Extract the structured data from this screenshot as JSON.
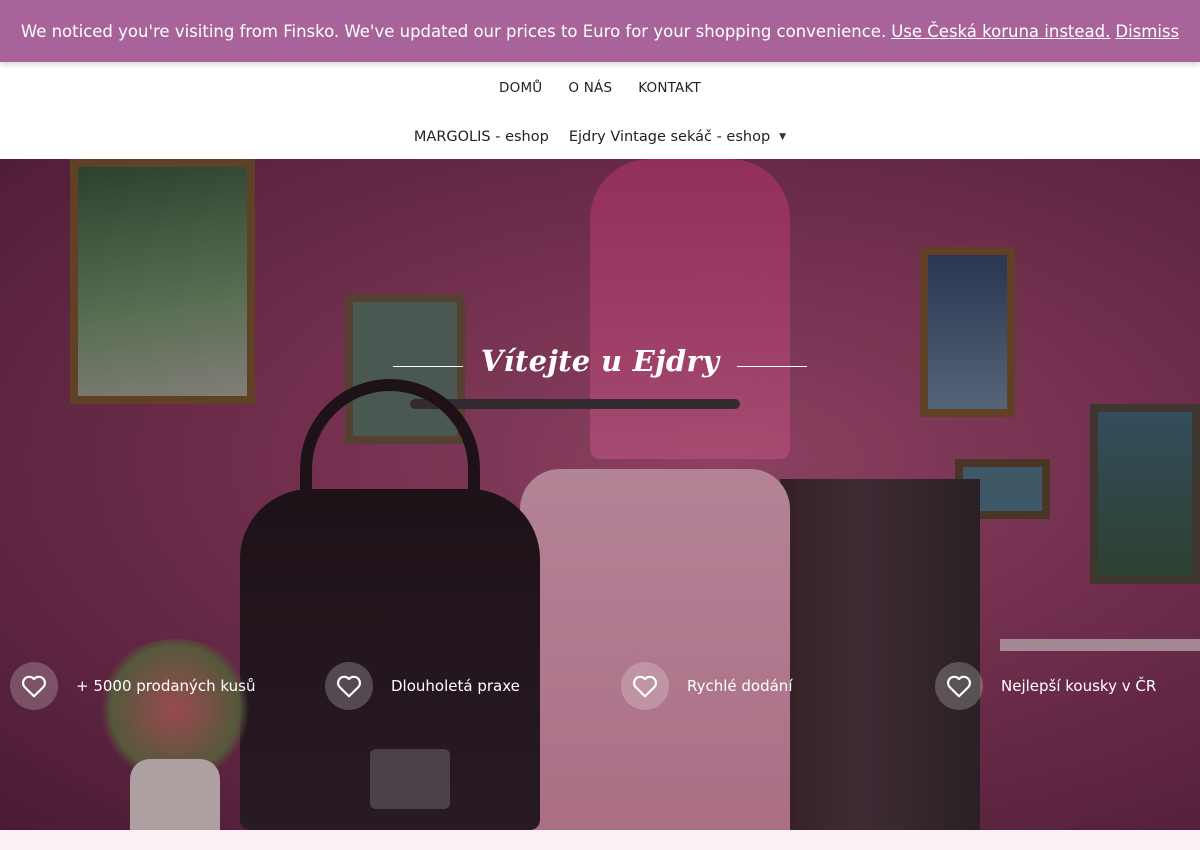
{
  "banner": {
    "message": "We noticed you're visiting from Finsko. We've updated our prices to Euro for your shopping convenience.",
    "currency_link": "Use Česká koruna instead.",
    "dismiss": "Dismiss",
    "color": "#a8649a"
  },
  "nav_primary": {
    "items": [
      {
        "label": "DOMŮ"
      },
      {
        "label": "O NÁS"
      },
      {
        "label": "KONTAKT"
      }
    ]
  },
  "nav_secondary": {
    "items": [
      {
        "label": "MARGOLIS - eshop"
      },
      {
        "label": "Ejdry Vintage sekáč - eshop",
        "icon": "caret-down-icon"
      }
    ]
  },
  "hero": {
    "title": "Vítejte u Ejdry",
    "features": [
      {
        "label": "+ 5000 prodaných kusů",
        "icon": "heart-icon"
      },
      {
        "label": "Dlouholetá praxe",
        "icon": "heart-icon"
      },
      {
        "label": "Rychlé dodání",
        "icon": "heart-icon"
      },
      {
        "label": "Nejlepší kousky v ČR",
        "icon": "heart-icon"
      }
    ]
  }
}
